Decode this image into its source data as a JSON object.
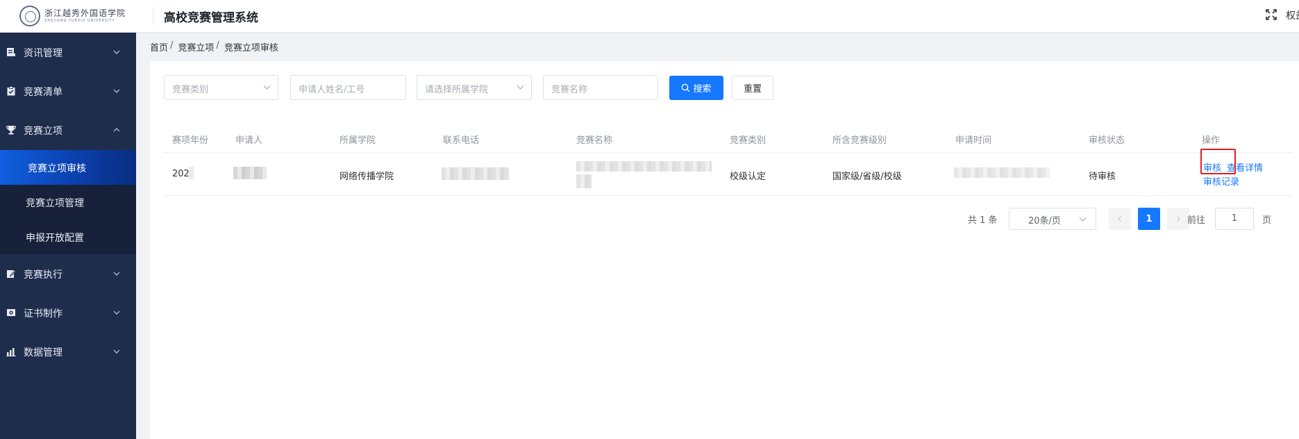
{
  "header": {
    "logo_cn": "浙江越秀外国语学院",
    "logo_en": "ZHEJIANG YUEXIU UNIVERSITY",
    "system_title": "高校竞赛管理系统",
    "user": "权益"
  },
  "sidebar": {
    "items": [
      {
        "label": "资讯管理",
        "icon": "document-icon"
      },
      {
        "label": "竞赛清单",
        "icon": "clipboard-check-icon"
      },
      {
        "label": "竞赛立项",
        "icon": "trophy-icon",
        "expanded": true
      },
      {
        "label": "竞赛执行",
        "icon": "edit-icon"
      },
      {
        "label": "证书制作",
        "icon": "certificate-icon"
      },
      {
        "label": "数据管理",
        "icon": "bar-chart-icon"
      }
    ],
    "subitems": [
      {
        "label": "竞赛立项审核",
        "active": true
      },
      {
        "label": "竞赛立项管理"
      },
      {
        "label": "申报开放配置"
      }
    ]
  },
  "breadcrumb": {
    "home": "首页",
    "parent": "竞赛立项",
    "current": "竞赛立项审核",
    "separator": "/"
  },
  "filters": {
    "category_placeholder": "竞赛类别",
    "applicant_placeholder": "申请人姓名/工号",
    "college_placeholder": "请选择所属学院",
    "name_placeholder": "竞赛名称",
    "search_label": "搜索",
    "reset_label": "重置"
  },
  "table": {
    "columns": [
      "赛项年份",
      "申请人",
      "所属学院",
      "联系电话",
      "竞赛名称",
      "竞赛类别",
      "所含竞赛级别",
      "申请时间",
      "审核状态",
      "操作"
    ],
    "rows": [
      {
        "year": "202",
        "college": "网络传播学院",
        "category": "校级认定",
        "level": "国家级/省级/校级",
        "status": "待审核",
        "actions": {
          "review": "审核",
          "details": "查看详情",
          "history": "审核记录"
        }
      }
    ]
  },
  "pagination": {
    "total_text": "共 1 条",
    "page_size": "20条/页",
    "current_page": "1",
    "goto_label": "前往",
    "goto_value": "1",
    "page_unit": "页"
  },
  "colors": {
    "primary": "#1677ff",
    "sidebar_bg": "#1f2d4d",
    "highlight": "#e02020"
  }
}
